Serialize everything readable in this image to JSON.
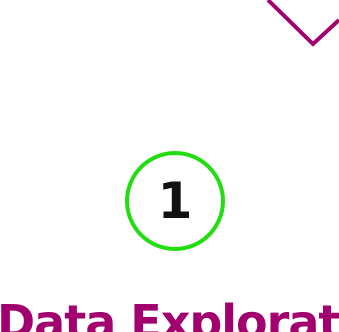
{
  "step": {
    "number": "1",
    "ring_color": "#22dd11"
  },
  "title": {
    "text": "Data Explorati",
    "color": "#a3006f"
  },
  "decoration": {
    "icon": "diamond-outline-icon",
    "color": "#a3006f"
  }
}
